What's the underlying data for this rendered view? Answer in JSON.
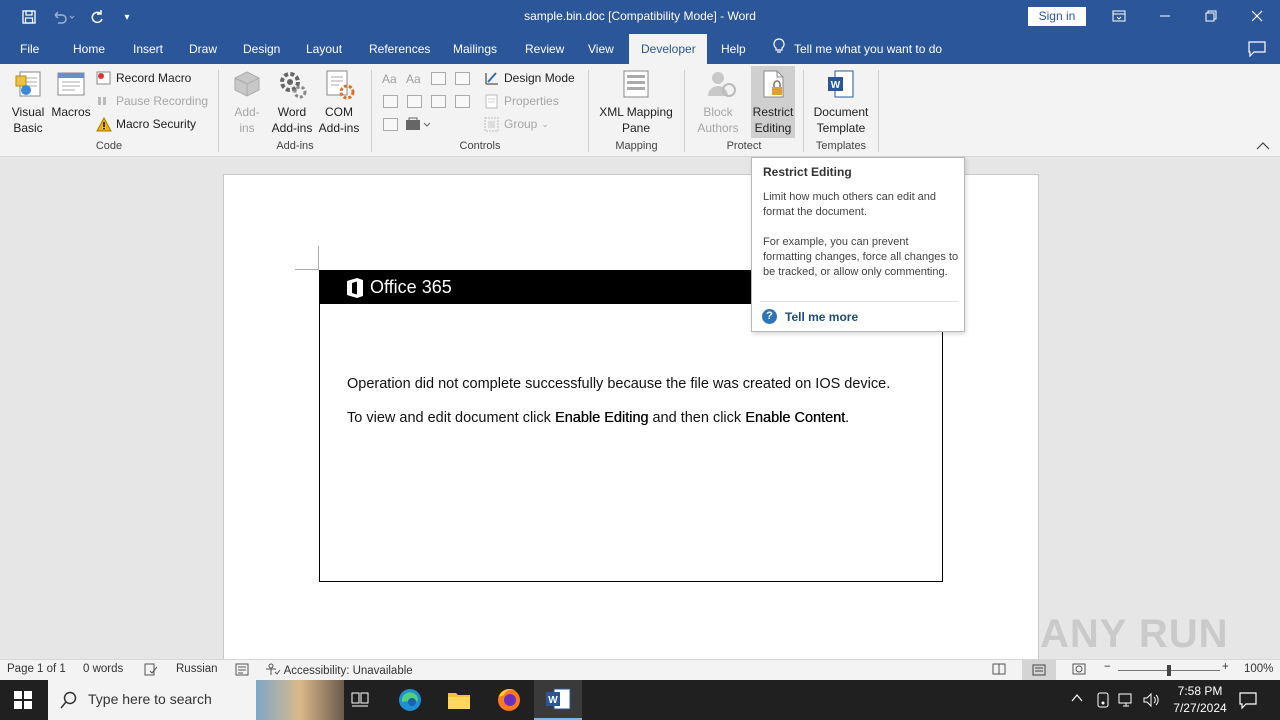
{
  "window": {
    "title": "sample.bin.doc [Compatibility Mode]  -  Word",
    "sign_in": "Sign in",
    "quick_access": [
      "save-icon",
      "undo-icon",
      "redo-icon",
      "customize-icon"
    ]
  },
  "tabs": {
    "file": "File",
    "home": "Home",
    "insert": "Insert",
    "draw": "Draw",
    "design": "Design",
    "layout": "Layout",
    "references": "References",
    "mailings": "Mailings",
    "review": "Review",
    "view": "View",
    "developer": "Developer",
    "help": "Help",
    "tell_me": "Tell me what you want to do"
  },
  "ribbon": {
    "code": {
      "label": "Code",
      "visual_basic": "Visual Basic",
      "macros": "Macros",
      "record_macro": "Record Macro",
      "pause_recording": "Pause Recording",
      "macro_security": "Macro Security"
    },
    "addins": {
      "label": "Add-ins",
      "addins": "Add-ins",
      "word_addins": "Word Add-ins",
      "com_addins": "COM Add-ins"
    },
    "controls": {
      "label": "Controls",
      "design_mode": "Design Mode",
      "properties": "Properties",
      "group": "Group"
    },
    "mapping": {
      "label": "Mapping",
      "xml_mapping_pane": "XML Mapping Pane"
    },
    "protect": {
      "label": "Protect",
      "block_authors": "Block Authors",
      "restrict_editing": "Restrict Editing"
    },
    "templates": {
      "label": "Templates",
      "document_template": "Document Template"
    }
  },
  "tooltip": {
    "title": "Restrict Editing",
    "para1": "Limit how much others can edit and format the document.",
    "para2": "For example, you can prevent formatting changes, force all changes to be tracked, or allow only commenting.",
    "link": "Tell me more"
  },
  "document": {
    "brand": "Office 365",
    "line1": "Operation did not complete successfully because the file was created on IOS device.",
    "line2_pre": "To view and edit document click ",
    "line2_b1": "Enable Editing",
    "line2_mid": " and then click ",
    "line2_b2": "Enable Content",
    "line2_end": "."
  },
  "status": {
    "page": "Page 1 of 1",
    "words": "0 words",
    "language": "Russian",
    "accessibility": "Accessibility: Unavailable",
    "zoom": "100%",
    "zoom_fraction": 0.5
  },
  "taskbar": {
    "search_placeholder": "Type here to search",
    "time": "7:58 PM",
    "date": "7/27/2024"
  },
  "watermark": "ANY RUN",
  "colors": {
    "accent": "#2b579a",
    "taskbar": "#202020"
  }
}
